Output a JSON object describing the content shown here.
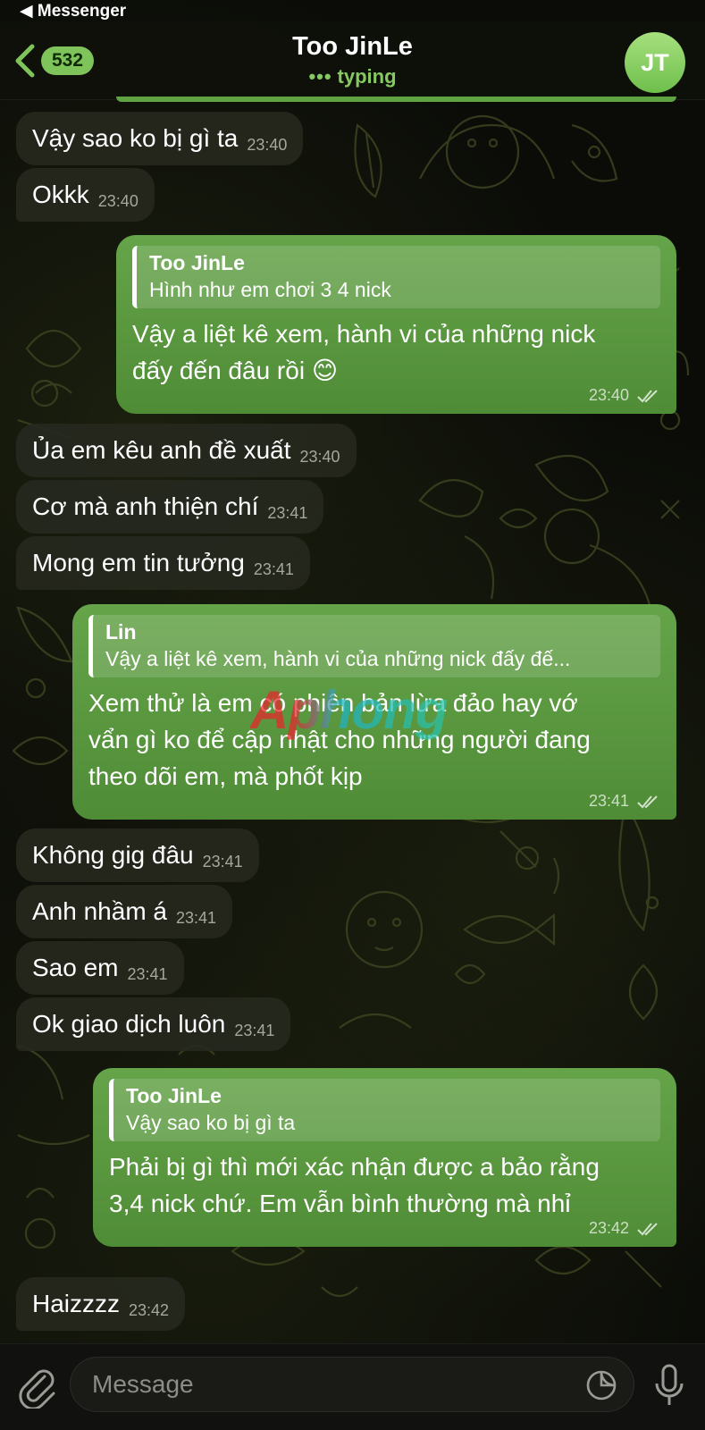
{
  "status_bar": {
    "back_app": "◀ Messenger"
  },
  "header": {
    "back_count": "532",
    "title": "Too JinLe",
    "status_dots": "•••",
    "status": "typing",
    "avatar_initials": "JT"
  },
  "messages": [
    {
      "dir": "in",
      "text": "Vậy sao ko bị gì ta",
      "time": "23:40"
    },
    {
      "dir": "in",
      "text": "Okkk",
      "time": "23:40"
    },
    {
      "dir": "out",
      "reply_name": "Too JinLe",
      "reply_text": "Hình như em chơi 3 4 nick",
      "text_line1": "Vậy a liệt kê xem, hành vi của những nick",
      "text_line2": "đấy đến đâu rồi 😊",
      "time": "23:40"
    },
    {
      "dir": "in",
      "text": "Ủa em kêu anh đề xuất",
      "time": "23:40"
    },
    {
      "dir": "in",
      "text": "Cơ mà anh thiện chí",
      "time": "23:41"
    },
    {
      "dir": "in",
      "text": "Mong em tin tưởng",
      "time": "23:41"
    },
    {
      "dir": "out",
      "reply_name": "Lin",
      "reply_text": "Vậy a liệt kê xem, hành vi của những nick đấy đế...",
      "text_line1": "Xem thử là em có phiên bản lừa đảo hay vớ",
      "text_line2": "vẩn gì ko để cập nhật cho những người đang",
      "text_line3": "theo dõi em, mà phốt kịp",
      "time": "23:41"
    },
    {
      "dir": "in",
      "text": "Không gig đâu",
      "time": "23:41"
    },
    {
      "dir": "in",
      "text": "Anh nhầm á",
      "time": "23:41"
    },
    {
      "dir": "in",
      "text": "Sao em",
      "time": "23:41"
    },
    {
      "dir": "in",
      "text": "Ok giao dịch luôn",
      "time": "23:41"
    },
    {
      "dir": "out",
      "reply_name": "Too JinLe",
      "reply_text": "Vậy sao ko bị gì ta",
      "text_line1": "Phải bị gì thì mới xác nhận được a bảo rằng",
      "text_line2": "3,4 nick chứ. Em vẫn bình thường mà nhỉ",
      "time": "23:42"
    },
    {
      "dir": "in",
      "text": "Haizzzz",
      "time": "23:42"
    }
  ],
  "watermark": "Aphong",
  "composer": {
    "placeholder": "Message"
  },
  "colors": {
    "outgoing": "#5a9a3f",
    "incoming": "#26281e",
    "accent": "#7fc45a"
  },
  "icons": [
    "chevron-left-icon",
    "paperclip-icon",
    "sticker-icon",
    "microphone-icon",
    "double-check-icon"
  ]
}
